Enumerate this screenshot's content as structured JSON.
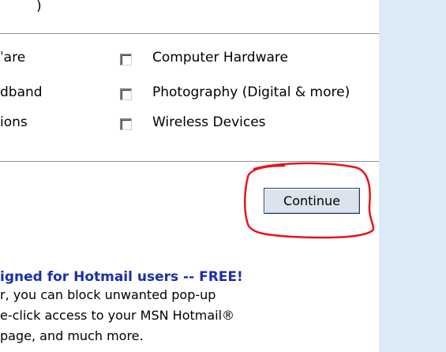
{
  "top_fragment": ")",
  "categories": {
    "left": [
      "ˈare",
      "dband",
      "ions"
    ],
    "right": [
      "Computer Hardware",
      "Photography (Digital & more)",
      "Wireless Devices"
    ]
  },
  "continue_button": "Continue",
  "promo": {
    "headline": "igned for Hotmail users -- FREE!",
    "lines": [
      "r, you can block unwanted pop-up",
      "e-click access to your MSN Hotmail®",
      "page, and much more."
    ]
  },
  "colors": {
    "headline": "#1a2fa8",
    "side_panel": "#dce9f6",
    "annotation": "#e8141c"
  }
}
